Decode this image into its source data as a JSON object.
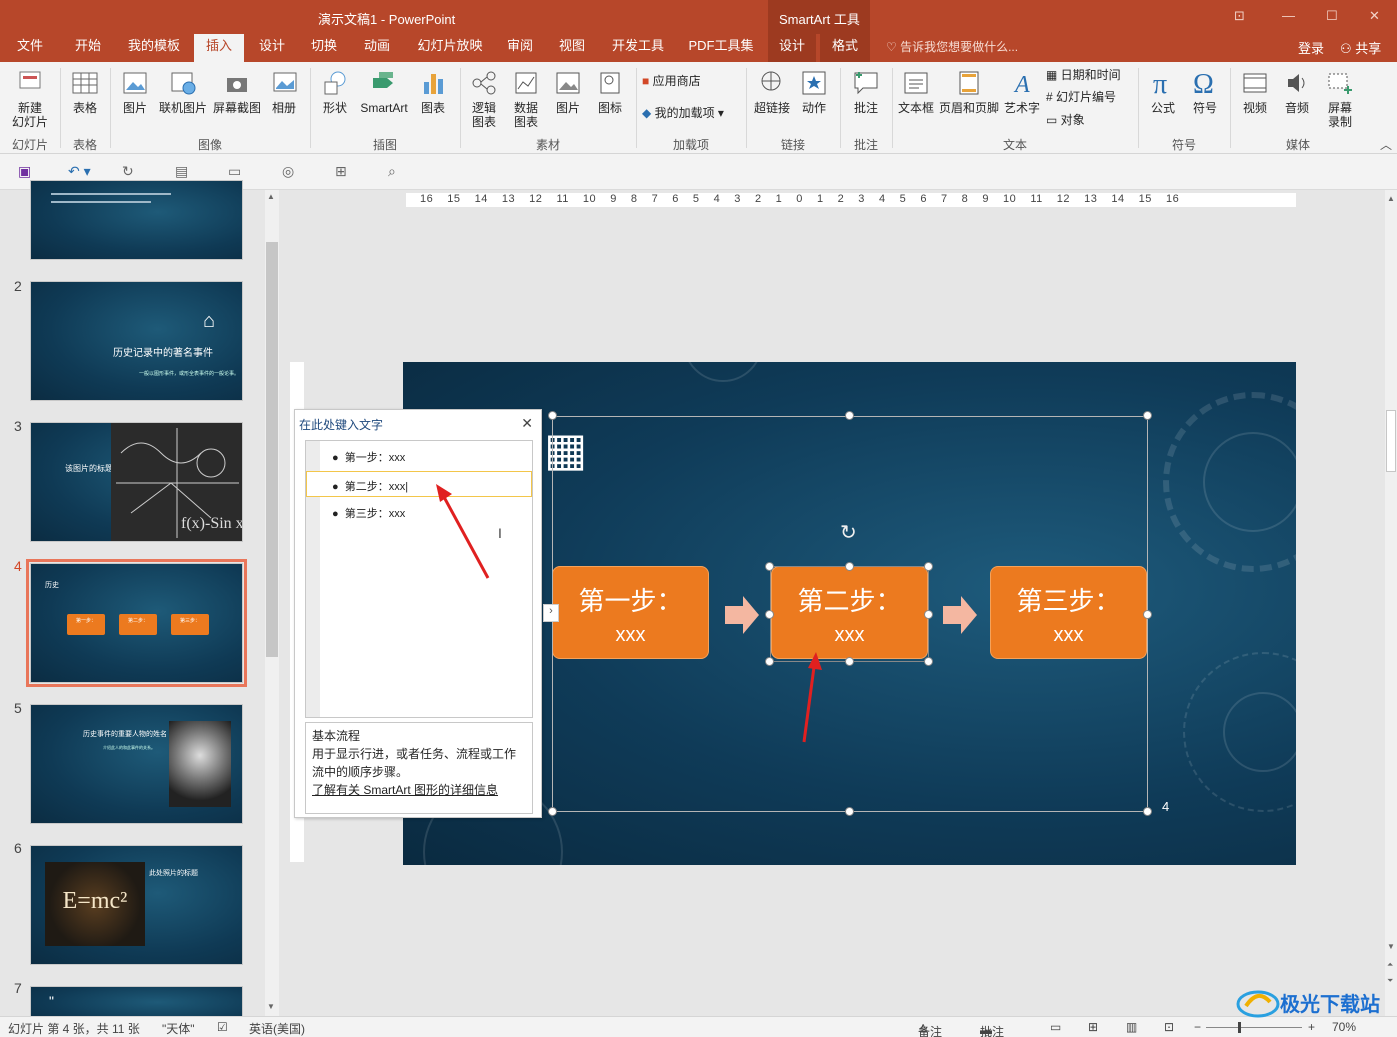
{
  "window": {
    "title": "演示文稿1 - PowerPoint",
    "context_tools": "SmartArt 工具",
    "controls": [
      "⊡",
      "—",
      "☐",
      "✕"
    ]
  },
  "tabs": [
    "文件",
    "开始",
    "我的模板",
    "插入",
    "设计",
    "切换",
    "动画",
    "幻灯片放映",
    "审阅",
    "视图",
    "开发工具",
    "PDF工具集",
    "设计",
    "格式"
  ],
  "active_tab": "插入",
  "tell_me": "告诉我您想要做什么...",
  "login": "登录",
  "share": "共享",
  "ribbon": {
    "new_slide": "新建\n幻灯片",
    "table": "表格",
    "picture": "图片",
    "online_picture": "联机图片",
    "screenshot": "屏幕截图",
    "album": "相册",
    "shapes": "形状",
    "smartart": "SmartArt",
    "chart": "图表",
    "logic_chart": "逻辑\n图表",
    "data_chart": "数据\n图表",
    "picture2": "图片",
    "icon": "图标",
    "app_store": "应用商店",
    "my_addins": "我的加载项",
    "hyperlink": "超链接",
    "action": "动作",
    "comment": "批注",
    "textbox": "文本框",
    "header_footer": "页眉和页脚",
    "wordart": "艺术字",
    "datetime": "日期和时间",
    "slide_number": "幻灯片编号",
    "object": "对象",
    "equation": "公式",
    "symbol": "符号",
    "video": "视频",
    "audio": "音频",
    "screen_record": "屏幕\n录制",
    "groups": [
      "幻灯片",
      "表格",
      "图像",
      "插图",
      "素材",
      "加载项",
      "链接",
      "批注",
      "文本",
      "符号",
      "媒体"
    ]
  },
  "ruler": "16 15 14 13 12 11 10 9 8 7 6 5 4 3 2 1 0 1 2 3 4 5 6 7 8 9 10 11 12 13 14 15 16",
  "thumbnails": [
    {
      "num": "2",
      "title": "历史记录中的著名事件",
      "sub": "一般以图形事件，或形全表事件的一般论事。"
    },
    {
      "num": "3",
      "title": "该图片的标题"
    },
    {
      "num": "4",
      "title": "历史",
      "steps": [
        "第一步：",
        "第二步：",
        "第三步："
      ],
      "selected": true
    },
    {
      "num": "5",
      "title": "历史事件的重要人物的姓名",
      "sub": "介绍此人的和此事件的关系。"
    },
    {
      "num": "6",
      "title": "此处照片的标题",
      "formula": "E=mc²"
    },
    {
      "num": "7",
      "quote": "\""
    }
  ],
  "text_pane": {
    "title": "在此处键入文字",
    "close": "✕",
    "bullets": [
      "第一步：xxx",
      "第二步：xxx",
      "第三步：xxx"
    ],
    "layout_name": "基本流程",
    "layout_desc": "用于显示行进，或者任务、流程或工作流中的顺序步骤。",
    "learn_more": "了解有关 SmartArt 图形的详细信息"
  },
  "slide": {
    "boxes": [
      {
        "title": "第一步：",
        "text": "xxx"
      },
      {
        "title": "第二步：",
        "text": "xxx"
      },
      {
        "title": "第三步：",
        "text": "xxx"
      }
    ],
    "page_number": "4"
  },
  "status": {
    "slide_info": "幻灯片 第 4 张，共 11 张",
    "theme": "\"天体\"",
    "language": "英语(美国)",
    "notes": "备注",
    "comments": "批注",
    "zoom": "70%"
  },
  "watermark": "极光下载站"
}
